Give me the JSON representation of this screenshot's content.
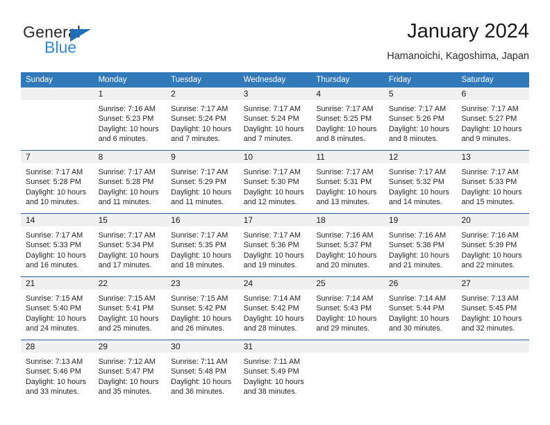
{
  "brand": {
    "name_part1": "General",
    "name_part2": "Blue",
    "triangle_color": "#1f6fb8",
    "blue_color": "#2e8ad6"
  },
  "header": {
    "title": "January 2024",
    "subtitle": "Hamanoichi, Kagoshima, Japan"
  },
  "theme": {
    "header_bg": "#3179b9",
    "week_rule": "#1f6098",
    "daynum_bg": "#f0f0f0"
  },
  "weekdays": [
    "Sunday",
    "Monday",
    "Tuesday",
    "Wednesday",
    "Thursday",
    "Friday",
    "Saturday"
  ],
  "weeks": [
    {
      "days": [
        {
          "num": "",
          "sunrise": "",
          "sunset": "",
          "daylight1": "",
          "daylight2": ""
        },
        {
          "num": "1",
          "sunrise": "Sunrise: 7:16 AM",
          "sunset": "Sunset: 5:23 PM",
          "daylight1": "Daylight: 10 hours",
          "daylight2": "and 6 minutes."
        },
        {
          "num": "2",
          "sunrise": "Sunrise: 7:17 AM",
          "sunset": "Sunset: 5:24 PM",
          "daylight1": "Daylight: 10 hours",
          "daylight2": "and 7 minutes."
        },
        {
          "num": "3",
          "sunrise": "Sunrise: 7:17 AM",
          "sunset": "Sunset: 5:24 PM",
          "daylight1": "Daylight: 10 hours",
          "daylight2": "and 7 minutes."
        },
        {
          "num": "4",
          "sunrise": "Sunrise: 7:17 AM",
          "sunset": "Sunset: 5:25 PM",
          "daylight1": "Daylight: 10 hours",
          "daylight2": "and 8 minutes."
        },
        {
          "num": "5",
          "sunrise": "Sunrise: 7:17 AM",
          "sunset": "Sunset: 5:26 PM",
          "daylight1": "Daylight: 10 hours",
          "daylight2": "and 8 minutes."
        },
        {
          "num": "6",
          "sunrise": "Sunrise: 7:17 AM",
          "sunset": "Sunset: 5:27 PM",
          "daylight1": "Daylight: 10 hours",
          "daylight2": "and 9 minutes."
        }
      ]
    },
    {
      "days": [
        {
          "num": "7",
          "sunrise": "Sunrise: 7:17 AM",
          "sunset": "Sunset: 5:28 PM",
          "daylight1": "Daylight: 10 hours",
          "daylight2": "and 10 minutes."
        },
        {
          "num": "8",
          "sunrise": "Sunrise: 7:17 AM",
          "sunset": "Sunset: 5:28 PM",
          "daylight1": "Daylight: 10 hours",
          "daylight2": "and 11 minutes."
        },
        {
          "num": "9",
          "sunrise": "Sunrise: 7:17 AM",
          "sunset": "Sunset: 5:29 PM",
          "daylight1": "Daylight: 10 hours",
          "daylight2": "and 11 minutes."
        },
        {
          "num": "10",
          "sunrise": "Sunrise: 7:17 AM",
          "sunset": "Sunset: 5:30 PM",
          "daylight1": "Daylight: 10 hours",
          "daylight2": "and 12 minutes."
        },
        {
          "num": "11",
          "sunrise": "Sunrise: 7:17 AM",
          "sunset": "Sunset: 5:31 PM",
          "daylight1": "Daylight: 10 hours",
          "daylight2": "and 13 minutes."
        },
        {
          "num": "12",
          "sunrise": "Sunrise: 7:17 AM",
          "sunset": "Sunset: 5:32 PM",
          "daylight1": "Daylight: 10 hours",
          "daylight2": "and 14 minutes."
        },
        {
          "num": "13",
          "sunrise": "Sunrise: 7:17 AM",
          "sunset": "Sunset: 5:33 PM",
          "daylight1": "Daylight: 10 hours",
          "daylight2": "and 15 minutes."
        }
      ]
    },
    {
      "days": [
        {
          "num": "14",
          "sunrise": "Sunrise: 7:17 AM",
          "sunset": "Sunset: 5:33 PM",
          "daylight1": "Daylight: 10 hours",
          "daylight2": "and 16 minutes."
        },
        {
          "num": "15",
          "sunrise": "Sunrise: 7:17 AM",
          "sunset": "Sunset: 5:34 PM",
          "daylight1": "Daylight: 10 hours",
          "daylight2": "and 17 minutes."
        },
        {
          "num": "16",
          "sunrise": "Sunrise: 7:17 AM",
          "sunset": "Sunset: 5:35 PM",
          "daylight1": "Daylight: 10 hours",
          "daylight2": "and 18 minutes."
        },
        {
          "num": "17",
          "sunrise": "Sunrise: 7:17 AM",
          "sunset": "Sunset: 5:36 PM",
          "daylight1": "Daylight: 10 hours",
          "daylight2": "and 19 minutes."
        },
        {
          "num": "18",
          "sunrise": "Sunrise: 7:16 AM",
          "sunset": "Sunset: 5:37 PM",
          "daylight1": "Daylight: 10 hours",
          "daylight2": "and 20 minutes."
        },
        {
          "num": "19",
          "sunrise": "Sunrise: 7:16 AM",
          "sunset": "Sunset: 5:38 PM",
          "daylight1": "Daylight: 10 hours",
          "daylight2": "and 21 minutes."
        },
        {
          "num": "20",
          "sunrise": "Sunrise: 7:16 AM",
          "sunset": "Sunset: 5:39 PM",
          "daylight1": "Daylight: 10 hours",
          "daylight2": "and 22 minutes."
        }
      ]
    },
    {
      "days": [
        {
          "num": "21",
          "sunrise": "Sunrise: 7:15 AM",
          "sunset": "Sunset: 5:40 PM",
          "daylight1": "Daylight: 10 hours",
          "daylight2": "and 24 minutes."
        },
        {
          "num": "22",
          "sunrise": "Sunrise: 7:15 AM",
          "sunset": "Sunset: 5:41 PM",
          "daylight1": "Daylight: 10 hours",
          "daylight2": "and 25 minutes."
        },
        {
          "num": "23",
          "sunrise": "Sunrise: 7:15 AM",
          "sunset": "Sunset: 5:42 PM",
          "daylight1": "Daylight: 10 hours",
          "daylight2": "and 26 minutes."
        },
        {
          "num": "24",
          "sunrise": "Sunrise: 7:14 AM",
          "sunset": "Sunset: 5:42 PM",
          "daylight1": "Daylight: 10 hours",
          "daylight2": "and 28 minutes."
        },
        {
          "num": "25",
          "sunrise": "Sunrise: 7:14 AM",
          "sunset": "Sunset: 5:43 PM",
          "daylight1": "Daylight: 10 hours",
          "daylight2": "and 29 minutes."
        },
        {
          "num": "26",
          "sunrise": "Sunrise: 7:14 AM",
          "sunset": "Sunset: 5:44 PM",
          "daylight1": "Daylight: 10 hours",
          "daylight2": "and 30 minutes."
        },
        {
          "num": "27",
          "sunrise": "Sunrise: 7:13 AM",
          "sunset": "Sunset: 5:45 PM",
          "daylight1": "Daylight: 10 hours",
          "daylight2": "and 32 minutes."
        }
      ]
    },
    {
      "days": [
        {
          "num": "28",
          "sunrise": "Sunrise: 7:13 AM",
          "sunset": "Sunset: 5:46 PM",
          "daylight1": "Daylight: 10 hours",
          "daylight2": "and 33 minutes."
        },
        {
          "num": "29",
          "sunrise": "Sunrise: 7:12 AM",
          "sunset": "Sunset: 5:47 PM",
          "daylight1": "Daylight: 10 hours",
          "daylight2": "and 35 minutes."
        },
        {
          "num": "30",
          "sunrise": "Sunrise: 7:11 AM",
          "sunset": "Sunset: 5:48 PM",
          "daylight1": "Daylight: 10 hours",
          "daylight2": "and 36 minutes."
        },
        {
          "num": "31",
          "sunrise": "Sunrise: 7:11 AM",
          "sunset": "Sunset: 5:49 PM",
          "daylight1": "Daylight: 10 hours",
          "daylight2": "and 38 minutes."
        },
        {
          "num": "",
          "sunrise": "",
          "sunset": "",
          "daylight1": "",
          "daylight2": ""
        },
        {
          "num": "",
          "sunrise": "",
          "sunset": "",
          "daylight1": "",
          "daylight2": ""
        },
        {
          "num": "",
          "sunrise": "",
          "sunset": "",
          "daylight1": "",
          "daylight2": ""
        }
      ]
    }
  ]
}
